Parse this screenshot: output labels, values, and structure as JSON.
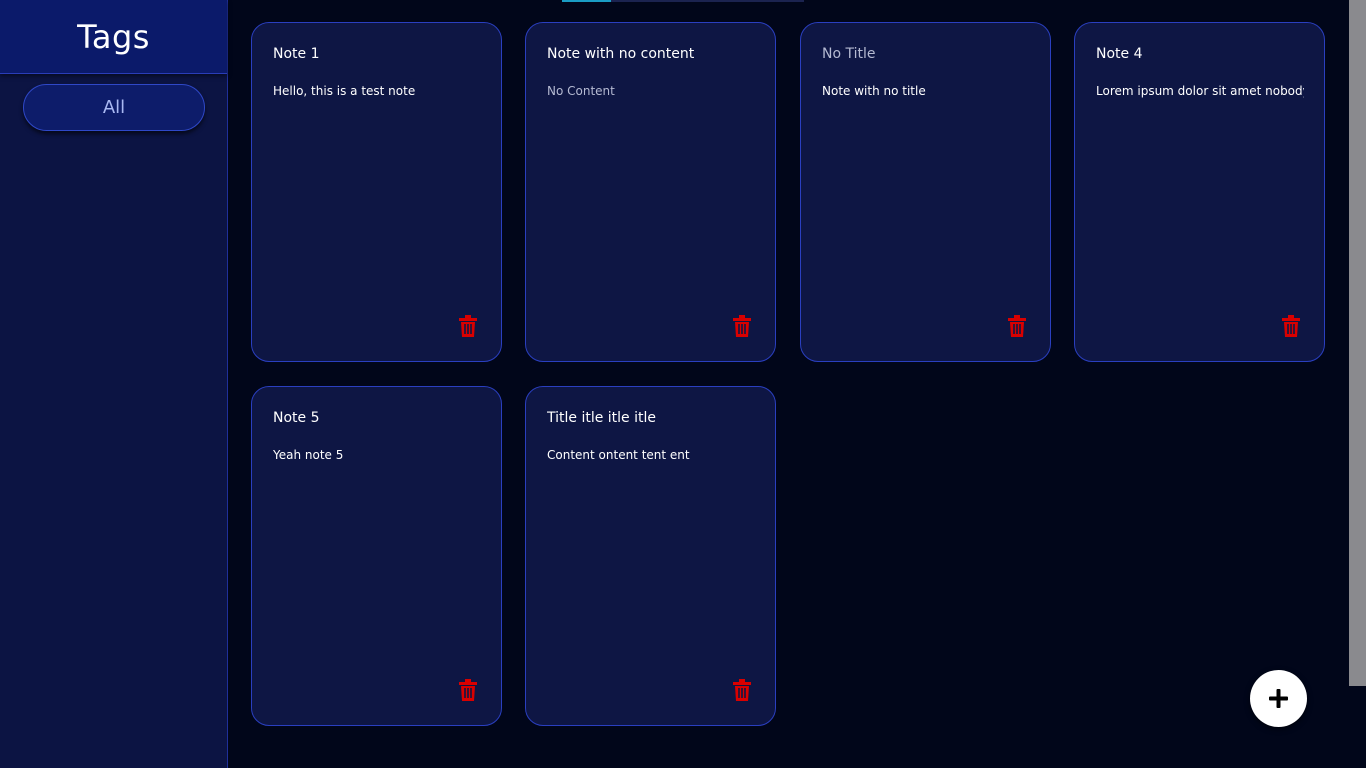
{
  "sidebar": {
    "title": "Tags",
    "tags": [
      {
        "label": "All"
      }
    ]
  },
  "notes": [
    {
      "title": "Note 1",
      "content": "Hello, this is a test note"
    },
    {
      "title": "Note with no content",
      "content": "No Content"
    },
    {
      "title": "No Title",
      "content": "Note with no title"
    },
    {
      "title": "Note 4",
      "content": "Lorem ipsum dolor sit amet nobody k"
    },
    {
      "title": "Note 5",
      "content": "Yeah note 5"
    },
    {
      "title": "Title itle itle itle",
      "content": "Content ontent tent ent"
    }
  ],
  "icons": {
    "delete": "trash-icon",
    "add": "plus-icon"
  },
  "colors": {
    "background": "#01061a",
    "sidebar": "#0c1443",
    "card": "#0e1644",
    "card_border": "#2a3fc0",
    "delete_icon": "#d90000",
    "fab": "#ffffff"
  }
}
